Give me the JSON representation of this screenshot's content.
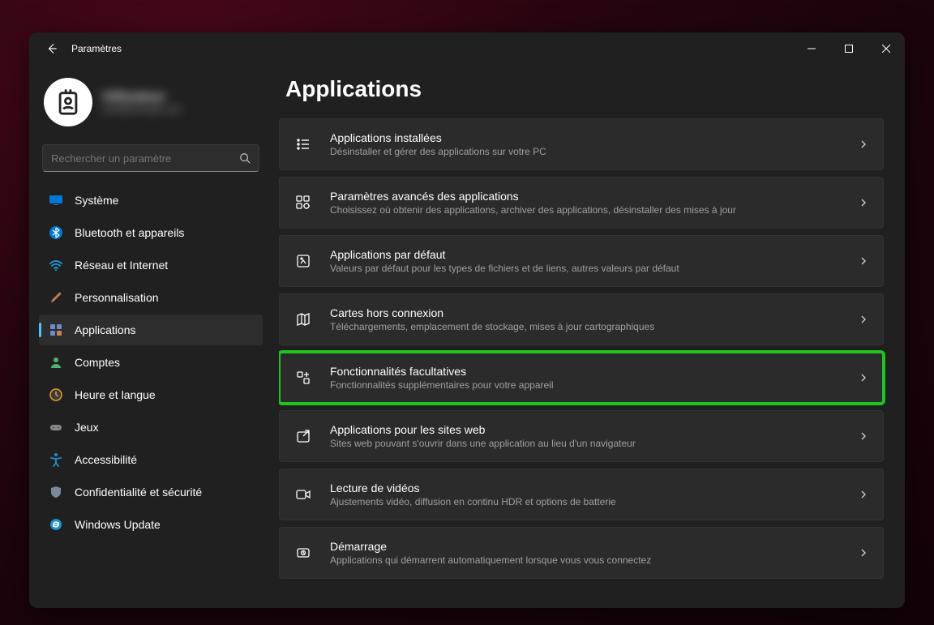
{
  "titlebar": {
    "title": "Paramètres"
  },
  "profile": {
    "name": "Utilisateur",
    "email": "user@example.com"
  },
  "search": {
    "placeholder": "Rechercher un paramètre"
  },
  "sidebar": {
    "items": [
      {
        "label": "Système"
      },
      {
        "label": "Bluetooth et appareils"
      },
      {
        "label": "Réseau et Internet"
      },
      {
        "label": "Personnalisation"
      },
      {
        "label": "Applications"
      },
      {
        "label": "Comptes"
      },
      {
        "label": "Heure et langue"
      },
      {
        "label": "Jeux"
      },
      {
        "label": "Accessibilité"
      },
      {
        "label": "Confidentialité et sécurité"
      },
      {
        "label": "Windows Update"
      }
    ]
  },
  "page": {
    "title": "Applications"
  },
  "cards": [
    {
      "title": "Applications installées",
      "sub": "Désinstaller et gérer des applications sur votre PC"
    },
    {
      "title": "Paramètres avancés des applications",
      "sub": "Choisissez où obtenir des applications, archiver des applications, désinstaller des mises à jour"
    },
    {
      "title": "Applications par défaut",
      "sub": "Valeurs par défaut pour les types de fichiers et de liens, autres valeurs par défaut"
    },
    {
      "title": "Cartes hors connexion",
      "sub": "Téléchargements, emplacement de stockage, mises à jour cartographiques"
    },
    {
      "title": "Fonctionnalités facultatives",
      "sub": "Fonctionnalités supplémentaires pour votre appareil"
    },
    {
      "title": "Applications pour les sites web",
      "sub": "Sites web pouvant s'ouvrir dans une application au lieu d'un navigateur"
    },
    {
      "title": "Lecture de vidéos",
      "sub": "Ajustements vidéo, diffusion en continu HDR et options de batterie"
    },
    {
      "title": "Démarrage",
      "sub": "Applications qui démarrent automatiquement lorsque vous vous connectez"
    }
  ]
}
